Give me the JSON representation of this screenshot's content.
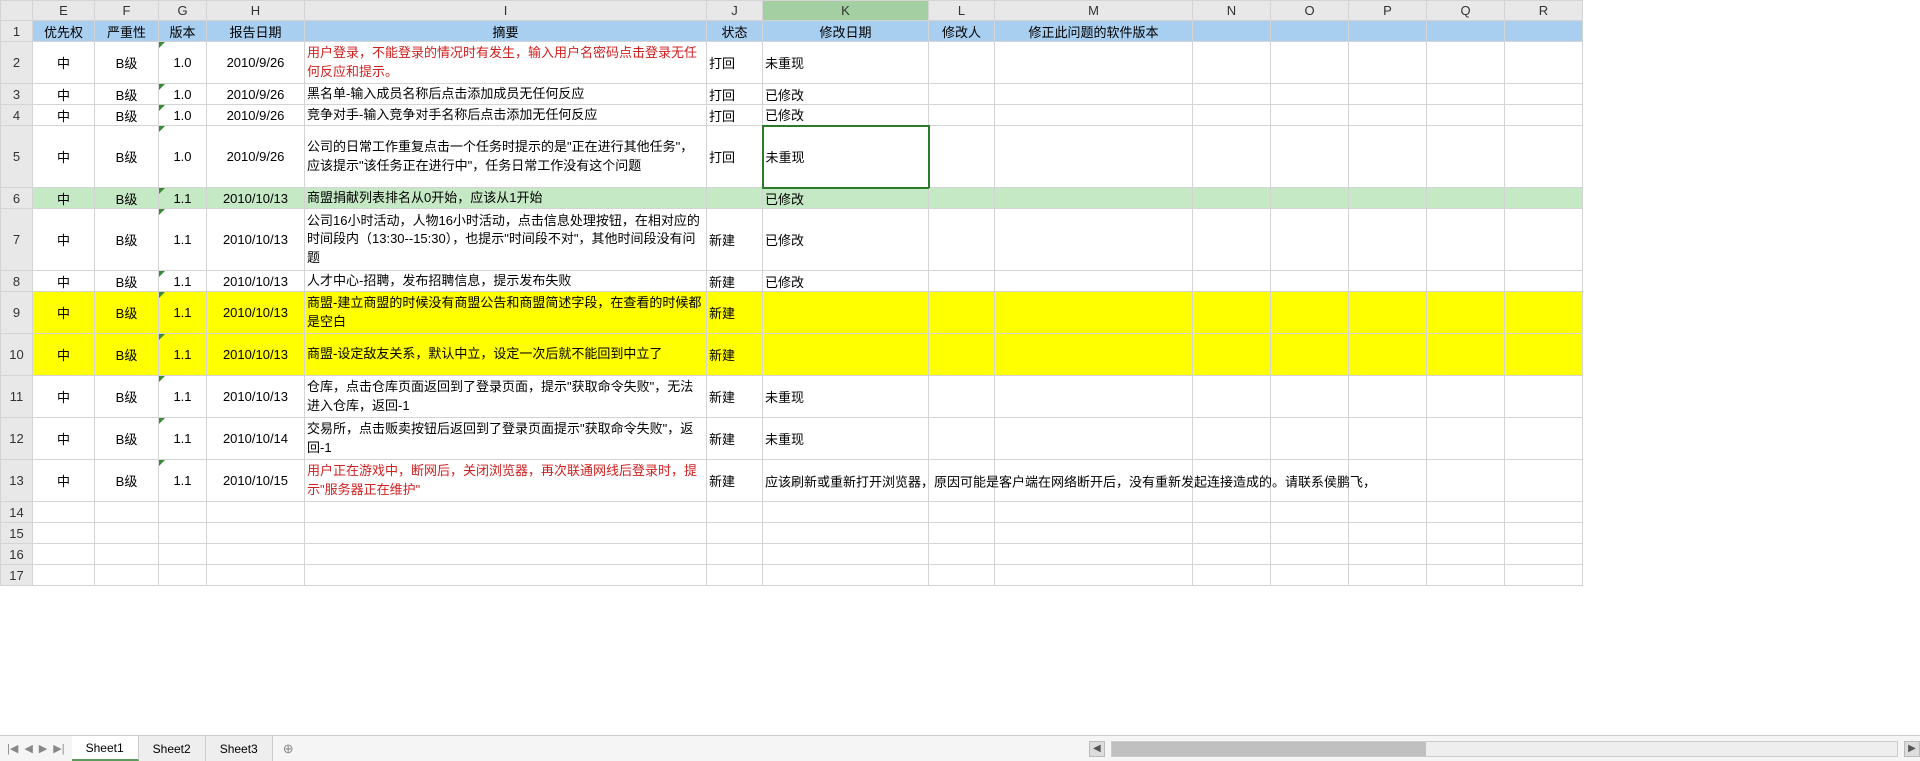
{
  "columns": [
    "E",
    "F",
    "G",
    "H",
    "I",
    "J",
    "K",
    "L",
    "M",
    "N",
    "O",
    "P",
    "Q",
    "R"
  ],
  "activeColumn": "K",
  "selectedCell": {
    "row": 5,
    "col": "K"
  },
  "headerRow": {
    "E": "优先权",
    "F": "严重性",
    "G": "版本",
    "H": "报告日期",
    "I": "摘要",
    "J": "状态",
    "K": "修改日期",
    "L": "修改人",
    "M": "修正此问题的软件版本",
    "N": "",
    "O": "",
    "P": "",
    "Q": "",
    "R": ""
  },
  "rows": [
    {
      "n": 2,
      "E": "中",
      "F": "B级",
      "G": "1.0",
      "H": "2010/9/26",
      "I": "用户登录，不能登录的情况时有发生，输入用户名密码点击登录无任何反应和提示。",
      "J": "打回",
      "K": "未重现",
      "redI": true,
      "tall": 2,
      "tri": true
    },
    {
      "n": 3,
      "E": "中",
      "F": "B级",
      "G": "1.0",
      "H": "2010/9/26",
      "I": "黑名单-输入成员名称后点击添加成员无任何反应",
      "J": "打回",
      "K": "已修改",
      "tri": true
    },
    {
      "n": 4,
      "E": "中",
      "F": "B级",
      "G": "1.0",
      "H": "2010/9/26",
      "I": "竞争对手-输入竞争对手名称后点击添加无任何反应",
      "J": "打回",
      "K": "已修改",
      "tri": true
    },
    {
      "n": 5,
      "E": "中",
      "F": "B级",
      "G": "1.0",
      "H": "2010/9/26",
      "I": "公司的日常工作重复点击一个任务时提示的是\"正在进行其他任务\"，应该提示\"该任务正在进行中\"，任务日常工作没有这个问题",
      "J": "打回",
      "K": "未重现",
      "tall": 3,
      "tri": true,
      "selected": true
    },
    {
      "n": 6,
      "E": "中",
      "F": "B级",
      "G": "1.1",
      "H": "2010/10/13",
      "I": "商盟捐献列表排名从0开始，应该从1开始",
      "J": "",
      "K": "已修改",
      "green": true,
      "tri": true
    },
    {
      "n": 7,
      "E": "中",
      "F": "B级",
      "G": "1.1",
      "H": "2010/10/13",
      "I": "公司16小时活动，人物16小时活动，点击信息处理按钮，在相对应的时间段内（13:30--15:30），也提示\"时间段不对\"，其他时间段没有问题",
      "J": "新建",
      "K": "已修改",
      "tall": 3,
      "tri": true
    },
    {
      "n": 8,
      "E": "中",
      "F": "B级",
      "G": "1.1",
      "H": "2010/10/13",
      "I": "人才中心-招聘，发布招聘信息，提示发布失败",
      "J": "新建",
      "K": "已修改",
      "tri": true
    },
    {
      "n": 9,
      "E": "中",
      "F": "B级",
      "G": "1.1",
      "H": "2010/10/13",
      "I": "商盟-建立商盟的时候没有商盟公告和商盟简述字段，在查看的时候都是空白",
      "J": "新建",
      "K": "",
      "yellow": true,
      "tall": 2,
      "tri": true
    },
    {
      "n": 10,
      "E": "中",
      "F": "B级",
      "G": "1.1",
      "H": "2010/10/13",
      "I": "商盟-设定敌友关系，默认中立，设定一次后就不能回到中立了",
      "J": "新建",
      "K": "",
      "yellow": true,
      "tall": 2,
      "tri": true
    },
    {
      "n": 11,
      "E": "中",
      "F": "B级",
      "G": "1.1",
      "H": "2010/10/13",
      "I": "仓库，点击仓库页面返回到了登录页面，提示\"获取命令失败\"，无法进入仓库，返回-1",
      "J": "新建",
      "K": "未重现",
      "tall": 2,
      "tri": true
    },
    {
      "n": 12,
      "E": "中",
      "F": "B级",
      "G": "1.1",
      "H": "2010/10/14",
      "I": "交易所，点击贩卖按钮后返回到了登录页面提示\"获取命令失败\"，返回-1",
      "J": "新建",
      "K": "未重现",
      "tall": 2,
      "tri": true
    },
    {
      "n": 13,
      "E": "中",
      "F": "B级",
      "G": "1.1",
      "H": "2010/10/15",
      "I": "用户正在游戏中，断网后，关闭浏览器，再次联通网线后登录时，提示\"服务器正在维护\"",
      "J": "新建",
      "K": "应该刷新或重新打开浏览器，原因可能是客户端在网络断开后，没有重新发起连接造成的。请联系侯鹏飞，",
      "redI": true,
      "tall": 2,
      "tri": true,
      "overflowK": true
    },
    {
      "n": 14
    },
    {
      "n": 15
    },
    {
      "n": 16
    },
    {
      "n": 17
    }
  ],
  "tabs": [
    "Sheet1",
    "Sheet2",
    "Sheet3"
  ],
  "activeTab": 0,
  "addTabGlyph": "⊕",
  "nav": {
    "first": "|◀",
    "prev": "◀",
    "next": "▶",
    "last": "▶|"
  },
  "scrollArrows": {
    "left": "◀",
    "right": "▶"
  }
}
